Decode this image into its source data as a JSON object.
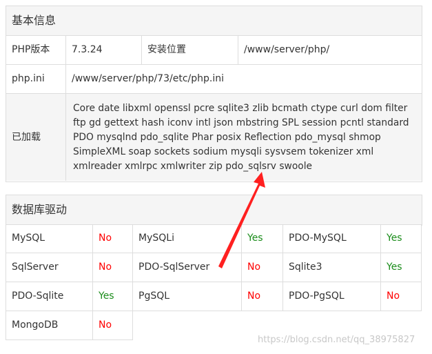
{
  "basic_info": {
    "title": "基本信息",
    "php_version_label": "PHP版本",
    "php_version_value": "7.3.24",
    "install_path_label": "安装位置",
    "install_path_value": "/www/server/php/",
    "phpini_label": "php.ini",
    "phpini_value": "/www/server/php/73/etc/php.ini",
    "loaded_label": "已加载",
    "loaded_value": "Core date libxml openssl pcre sqlite3 zlib bcmath ctype curl dom filter ftp gd gettext hash iconv intl json mbstring SPL session pcntl standard PDO mysqlnd pdo_sqlite Phar posix Reflection pdo_mysql shmop SimpleXML soap sockets sodium mysqli sysvsem tokenizer xml xmlreader xmlrpc xmlwriter zip pdo_sqlsrv swoole"
  },
  "db_drivers": {
    "title": "数据库驱动",
    "rows": [
      [
        {
          "name": "MySQL",
          "status": "No"
        },
        {
          "name": "MySQLi",
          "status": "Yes"
        },
        {
          "name": "PDO-MySQL",
          "status": "Yes"
        }
      ],
      [
        {
          "name": "SqlServer",
          "status": "No"
        },
        {
          "name": "PDO-SqlServer",
          "status": "No"
        },
        {
          "name": "Sqlite3",
          "status": "Yes"
        }
      ],
      [
        {
          "name": "PDO-Sqlite",
          "status": "Yes"
        },
        {
          "name": "PgSQL",
          "status": "No"
        },
        {
          "name": "PDO-PgSQL",
          "status": "No"
        }
      ],
      [
        {
          "name": "MongoDB",
          "status": "No"
        }
      ]
    ]
  },
  "annotation": {
    "arrow_color": "#ff2020"
  },
  "watermark": "https://blog.csdn.net/qq_38975827"
}
